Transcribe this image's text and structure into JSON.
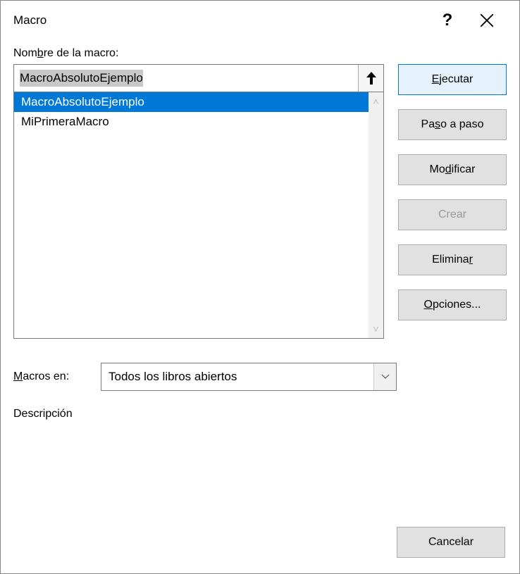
{
  "dialog": {
    "title": "Macro"
  },
  "labels": {
    "macro_name_pre": "Nom",
    "macro_name_u": "b",
    "macro_name_post": "re de la macro:",
    "macros_in_u": "M",
    "macros_in_post": "acros en:",
    "description": "Descripción"
  },
  "input": {
    "macro_name_value": "MacroAbsolutoEjemplo"
  },
  "list": {
    "items": [
      {
        "label": "MacroAbsolutoEjemplo",
        "selected": true
      },
      {
        "label": "MiPrimeraMacro",
        "selected": false
      }
    ]
  },
  "dropdown": {
    "macros_in_value": "Todos los libros abiertos"
  },
  "buttons": {
    "run_u": "E",
    "run_post": "jecutar",
    "step_pre": "Pa",
    "step_u": "s",
    "step_post": "o a paso",
    "edit_pre": "Mo",
    "edit_u": "d",
    "edit_post": "ificar",
    "create": "Crear",
    "delete_pre": "Elimina",
    "delete_u": "r",
    "options_u": "O",
    "options_post": "pciones...",
    "cancel": "Cancelar"
  }
}
